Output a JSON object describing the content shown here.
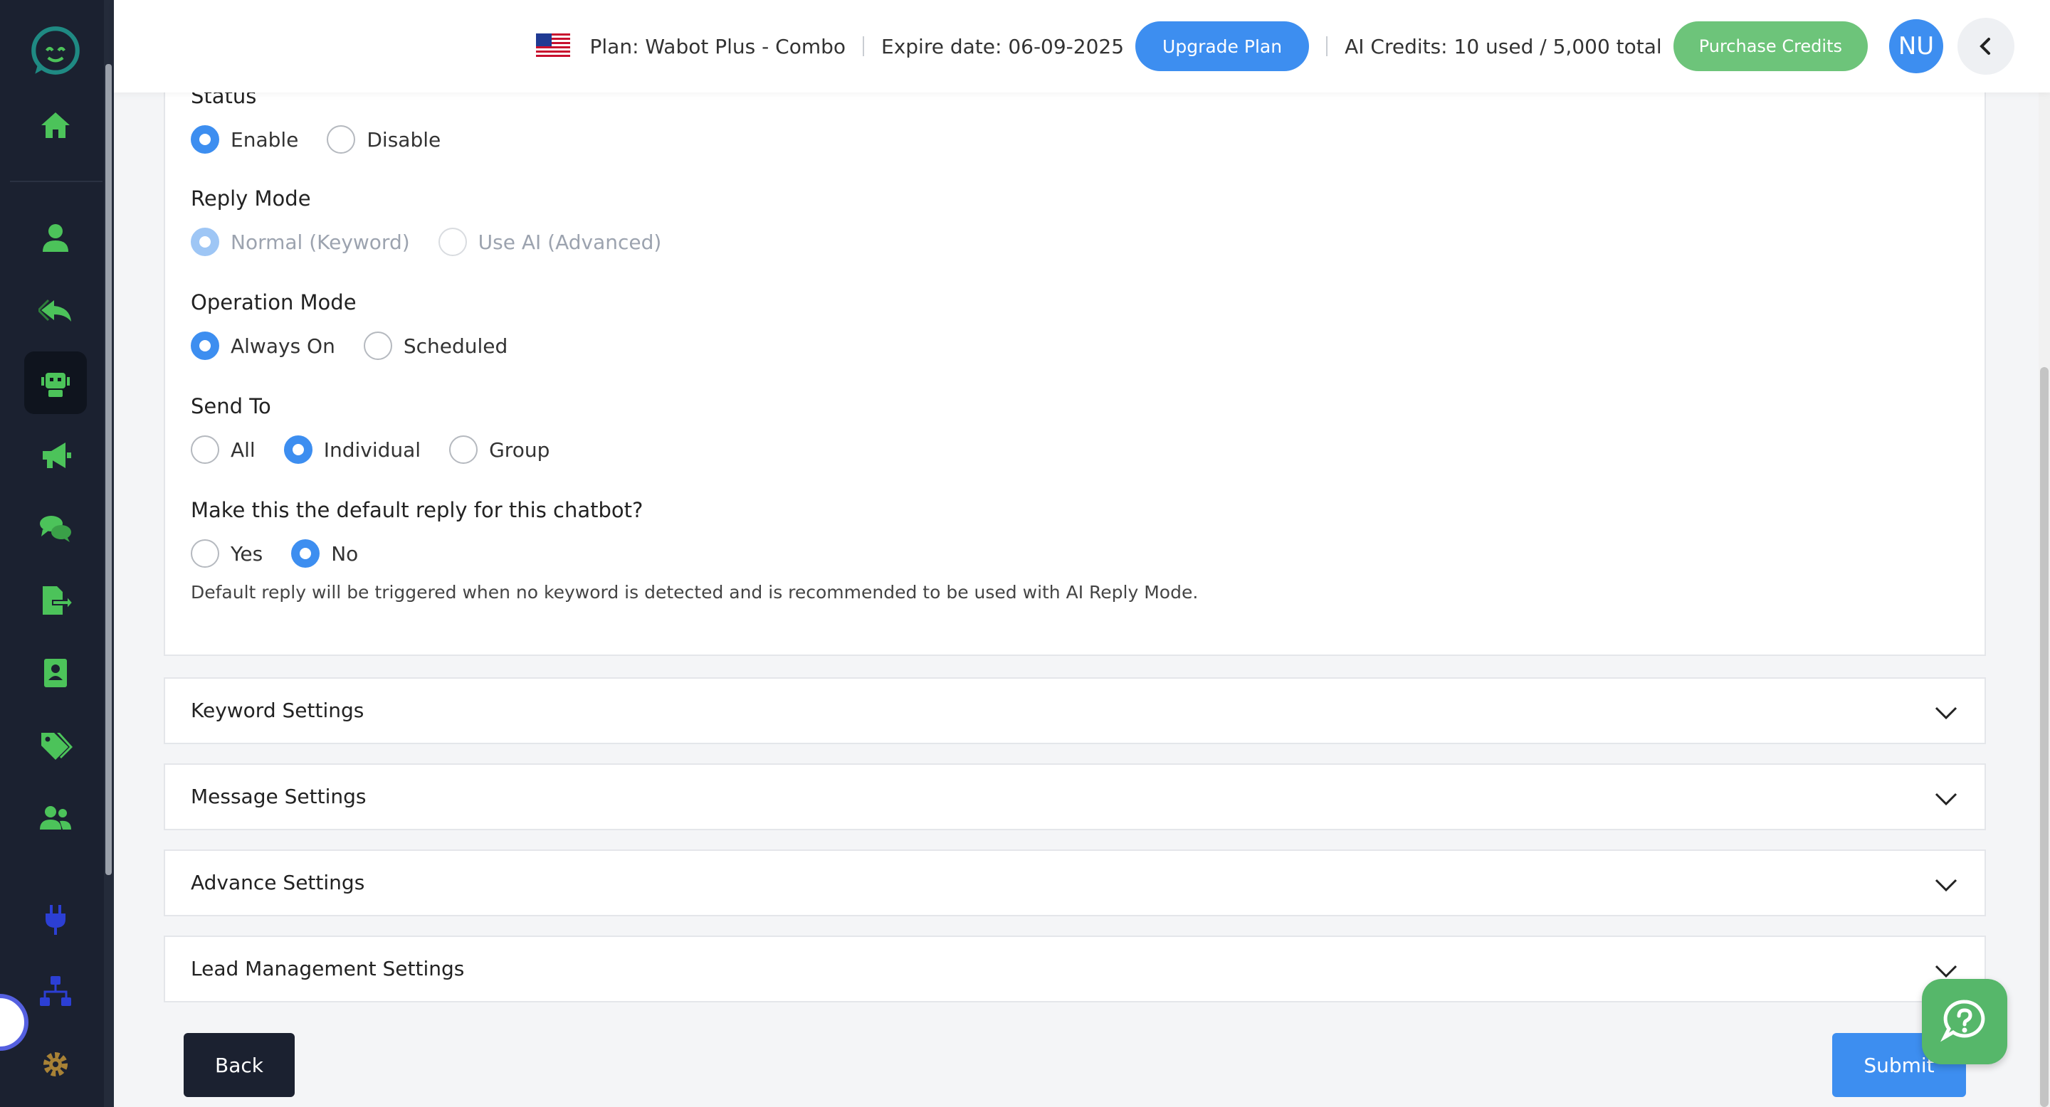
{
  "header": {
    "plan_text": "Plan: Wabot Plus - Combo",
    "expire_text": "Expire date: 06-09-2025",
    "upgrade_label": "Upgrade Plan",
    "credits_text": "AI Credits: 10 used / 5,000 total",
    "purchase_label": "Purchase Credits",
    "avatar_initials": "NU"
  },
  "form": {
    "status": {
      "label": "Status",
      "options": [
        "Enable",
        "Disable"
      ],
      "selected": "Enable"
    },
    "reply_mode": {
      "label": "Reply Mode",
      "options": [
        "Normal (Keyword)",
        "Use AI (Advanced)"
      ],
      "selected": "Normal (Keyword)",
      "disabled": true
    },
    "operation_mode": {
      "label": "Operation Mode",
      "options": [
        "Always On",
        "Scheduled"
      ],
      "selected": "Always On"
    },
    "send_to": {
      "label": "Send To",
      "options": [
        "All",
        "Individual",
        "Group"
      ],
      "selected": "Individual"
    },
    "default_reply": {
      "label": "Make this the default reply for this chatbot?",
      "options": [
        "Yes",
        "No"
      ],
      "selected": "No"
    },
    "default_help": "Default reply will be triggered when no keyword is detected and is recommended to be used with AI Reply Mode."
  },
  "accordions": [
    "Keyword Settings",
    "Message Settings",
    "Advance Settings",
    "Lead Management Settings"
  ],
  "footer": {
    "back_label": "Back",
    "submit_label": "Submit"
  },
  "colors": {
    "primary": "#3d8ef0",
    "success": "#6dc47a",
    "sidebar": "#1b2130",
    "sidebar_icon": "#4cc35a"
  }
}
